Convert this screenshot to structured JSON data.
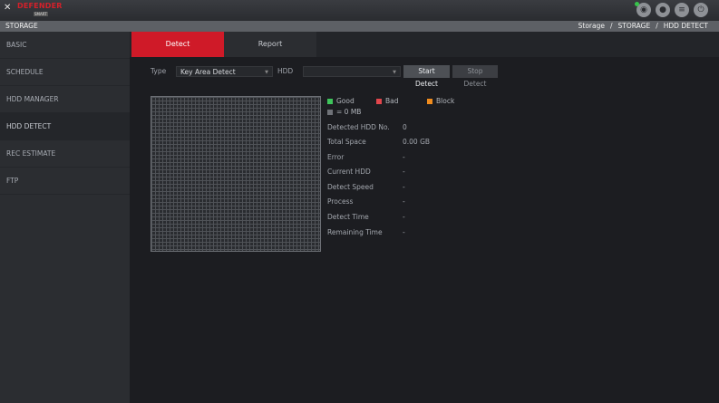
{
  "app": {
    "logo_text": "DEFENDER",
    "logo_sub": "SMART",
    "top_icons": [
      "eye-icon",
      "user-icon",
      "menu-icon",
      "power-icon"
    ]
  },
  "titlebar": {
    "title": "STORAGE",
    "breadcrumb": [
      "Storage",
      "STORAGE",
      "HDD DETECT"
    ],
    "separator": "/"
  },
  "sidebar": {
    "items": [
      {
        "label": "BASIC"
      },
      {
        "label": "SCHEDULE"
      },
      {
        "label": "HDD MANAGER"
      },
      {
        "label": "HDD DETECT"
      },
      {
        "label": "REC ESTIMATE"
      },
      {
        "label": "FTP"
      }
    ]
  },
  "tabs": [
    {
      "label": "Detect"
    },
    {
      "label": "Report"
    }
  ],
  "controls": {
    "type_label": "Type",
    "type_value": "Key Area Detect",
    "hdd_label": "HDD",
    "hdd_value": "",
    "start_button": "Start Detect",
    "stop_button": "Stop Detect"
  },
  "legend": {
    "good": "Good",
    "bad": "Bad",
    "block": "Block",
    "unit": "= 0 MB",
    "colors": {
      "good": "#3ec45b",
      "bad": "#e2464c",
      "block": "#f08c1e",
      "unit": "#6f7278"
    }
  },
  "info": [
    {
      "label": "Detected HDD No.",
      "value": "0"
    },
    {
      "label": "Total Space",
      "value": "0.00 GB"
    },
    {
      "label": "Error",
      "value": "-"
    },
    {
      "label": "Current HDD",
      "value": "-"
    },
    {
      "label": "Detect Speed",
      "value": "-"
    },
    {
      "label": "Process",
      "value": "-"
    },
    {
      "label": "Detect Time",
      "value": "-"
    },
    {
      "label": "Remaining Time",
      "value": "-"
    }
  ],
  "colors": {
    "accent": "#cf1a28"
  }
}
